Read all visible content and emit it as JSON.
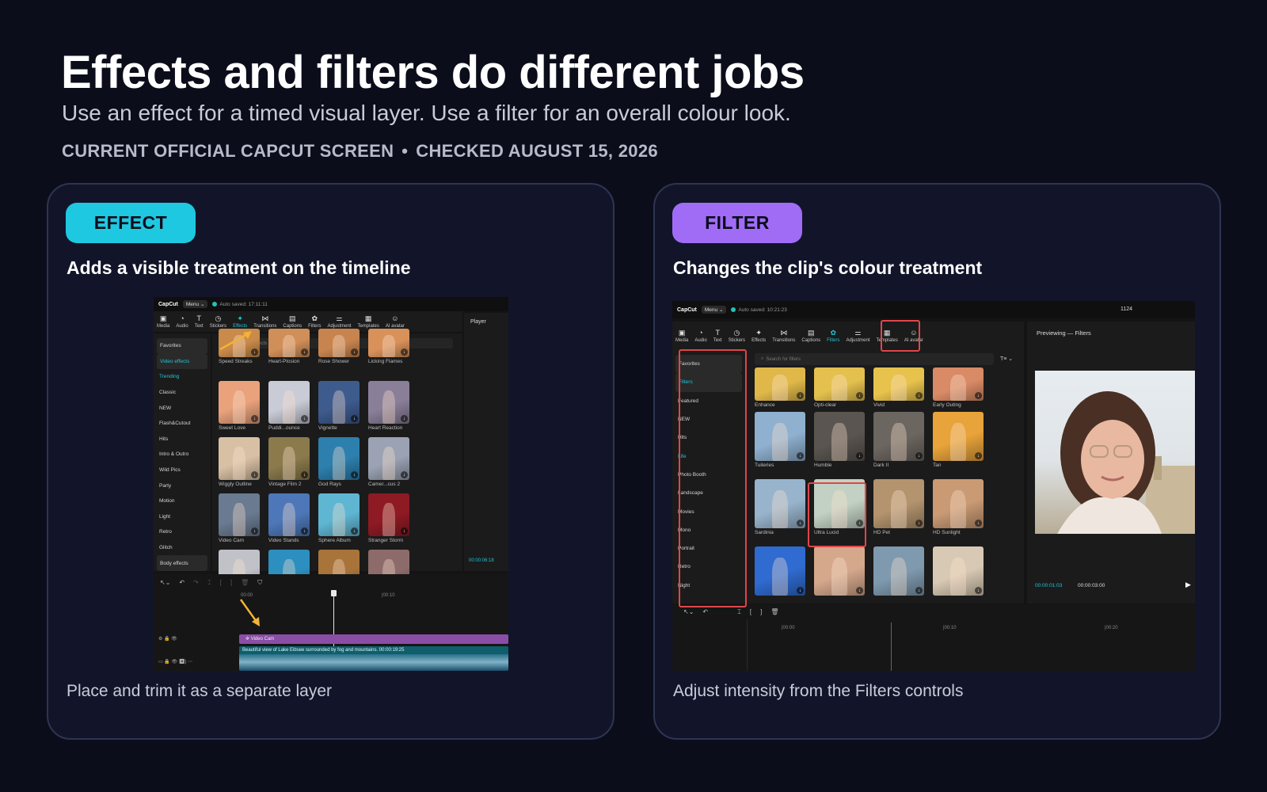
{
  "header": {
    "title": "Effects and filters do different jobs",
    "subtitle": "Use an effect for a timed visual layer. Use a filter for an overall colour look.",
    "meta_left": "CURRENT OFFICIAL CAPCUT SCREEN",
    "meta_sep": "•",
    "meta_right": "CHECKED AUGUST 15, 2026"
  },
  "colors": {
    "effect_accent": "#1ec8e0",
    "filter_accent": "#a06cf5",
    "highlight": "#e0464a",
    "app_teal": "#22c3d6"
  },
  "effect_card": {
    "pill": "EFFECT",
    "heading": "Adds a visible treatment on the timeline",
    "caption": "Place and trim it as a separate layer",
    "screenshot": {
      "logo": "CapCut",
      "menu": "Menu",
      "autosave": "Auto saved: 17:11:11",
      "toolbar": [
        "Media",
        "Audio",
        "Text",
        "Stickers",
        "Effects",
        "Transitions",
        "Captions",
        "Filters",
        "Adjustment",
        "Templates",
        "AI avatar"
      ],
      "toolbar_icons": [
        "media-icon",
        "audio-icon",
        "text-icon",
        "stickers-icon",
        "effects-icon",
        "transitions-icon",
        "captions-icon",
        "filters-icon",
        "adjustment-icon",
        "templates-icon",
        "ai-avatar-icon"
      ],
      "active_tool": "Effects",
      "search_placeholder": "Search for effects",
      "sidebar": [
        "Favorites",
        "Video effects",
        "Trending",
        "Classic",
        "NEW",
        "Flash&Cutout",
        "Hits",
        "Intro & Outro",
        "Wild Pics",
        "Party",
        "Motion",
        "Light",
        "Retro",
        "Glitch",
        "Body effects"
      ],
      "tiles": [
        {
          "label": "Speed Streaks",
          "color": "#c98a4a"
        },
        {
          "label": "Heart-Plosion",
          "color": "#d08e58"
        },
        {
          "label": "Rose Shower",
          "color": "#c7844f"
        },
        {
          "label": "Licking Flames",
          "color": "#d9915a"
        },
        {
          "label": "Sweet Love",
          "color": "#e9a27c"
        },
        {
          "label": "Puddi...ounce",
          "color": "#c9cbd6"
        },
        {
          "label": "Vignette",
          "color": "#3e5b8e"
        },
        {
          "label": "Heart Reaction",
          "color": "#8a7f99"
        },
        {
          "label": "Wiggly Outline",
          "color": "#d8c0a4"
        },
        {
          "label": "Vintage Film 2",
          "color": "#8b7a4c"
        },
        {
          "label": "God Rays",
          "color": "#2d7fae"
        },
        {
          "label": "Camer...cus 2",
          "color": "#9aa2b3"
        },
        {
          "label": "Video Cam",
          "color": "#6a7a90"
        },
        {
          "label": "Video Stands",
          "color": "#4d77b8"
        },
        {
          "label": "Sphere Album",
          "color": "#5fb6d2"
        },
        {
          "label": "Stranger Storm",
          "color": "#8e1a24"
        },
        {
          "label": "",
          "color": "#c0c2c8"
        },
        {
          "label": "",
          "color": "#2d8fbf"
        },
        {
          "label": "",
          "color": "#a8743a"
        },
        {
          "label": "",
          "color": "#8d6b6b"
        }
      ],
      "player_label": "Player",
      "player_time": "00:00:06:18",
      "ruler_start": "00:00",
      "ruler_mid": "|00:10",
      "effect_track_label": "Video Cam",
      "video_track_label": "Beautiful view of Lake Eibsee surrounded by fog and mountains.",
      "video_track_time": "00:00:19:25"
    }
  },
  "filter_card": {
    "pill": "FILTER",
    "heading": "Changes the clip's colour treatment",
    "caption": "Adjust intensity from the Filters controls",
    "screenshot": {
      "logo": "CapCut",
      "menu": "Menu",
      "autosave": "Auto saved: 10:21:23",
      "res": "1124",
      "toolbar": [
        "Media",
        "Audio",
        "Text",
        "Stickers",
        "Effects",
        "Transitions",
        "Captions",
        "Filters",
        "Adjustment",
        "Templates",
        "AI avatar"
      ],
      "toolbar_icons": [
        "media-icon",
        "audio-icon",
        "text-icon",
        "stickers-icon",
        "effects-icon",
        "transitions-icon",
        "captions-icon",
        "filters-icon",
        "adjustment-icon",
        "templates-icon",
        "ai-avatar-icon"
      ],
      "active_tool": "Filters",
      "search_placeholder": "Search for filters",
      "sort_label": "T≡ ⌄",
      "sidebar": [
        "Favorites",
        "Filters",
        "Featured",
        "NEW",
        "Hits",
        "Life",
        "Photo Booth",
        "Landscape",
        "Movies",
        "Mono",
        "Portrait",
        "Retro",
        "Night"
      ],
      "tiles": [
        {
          "label": "Enhance",
          "color": "#e0b84a"
        },
        {
          "label": "Opti-clear",
          "color": "#e4c04e"
        },
        {
          "label": "Vivid",
          "color": "#e7c24c"
        },
        {
          "label": "Early Outing",
          "color": "#d98a66"
        },
        {
          "label": "Tuileries",
          "color": "#8fb0cf"
        },
        {
          "label": "Humble",
          "color": "#5a5550"
        },
        {
          "label": "Dark II",
          "color": "#6c6660"
        },
        {
          "label": "Tan",
          "color": "#e8a33a"
        },
        {
          "label": "Sardinia",
          "color": "#98b4cc"
        },
        {
          "label": "Ultra Lucid",
          "color": "#c3d1c4"
        },
        {
          "label": "HD Pet",
          "color": "#b3946e"
        },
        {
          "label": "HD Sunlight",
          "color": "#c99a74"
        },
        {
          "label": "",
          "color": "#2f6bd0"
        },
        {
          "label": "",
          "color": "#d5a88c"
        },
        {
          "label": "",
          "color": "#7f9aaf"
        },
        {
          "label": "",
          "color": "#d8c9b4"
        }
      ],
      "preview_label": "Previewing — Filters",
      "time_current": "00:00:01:03",
      "time_total": "00:00:03:00",
      "ruler": [
        "|00:00",
        "|00:10",
        "|00:20"
      ]
    }
  }
}
